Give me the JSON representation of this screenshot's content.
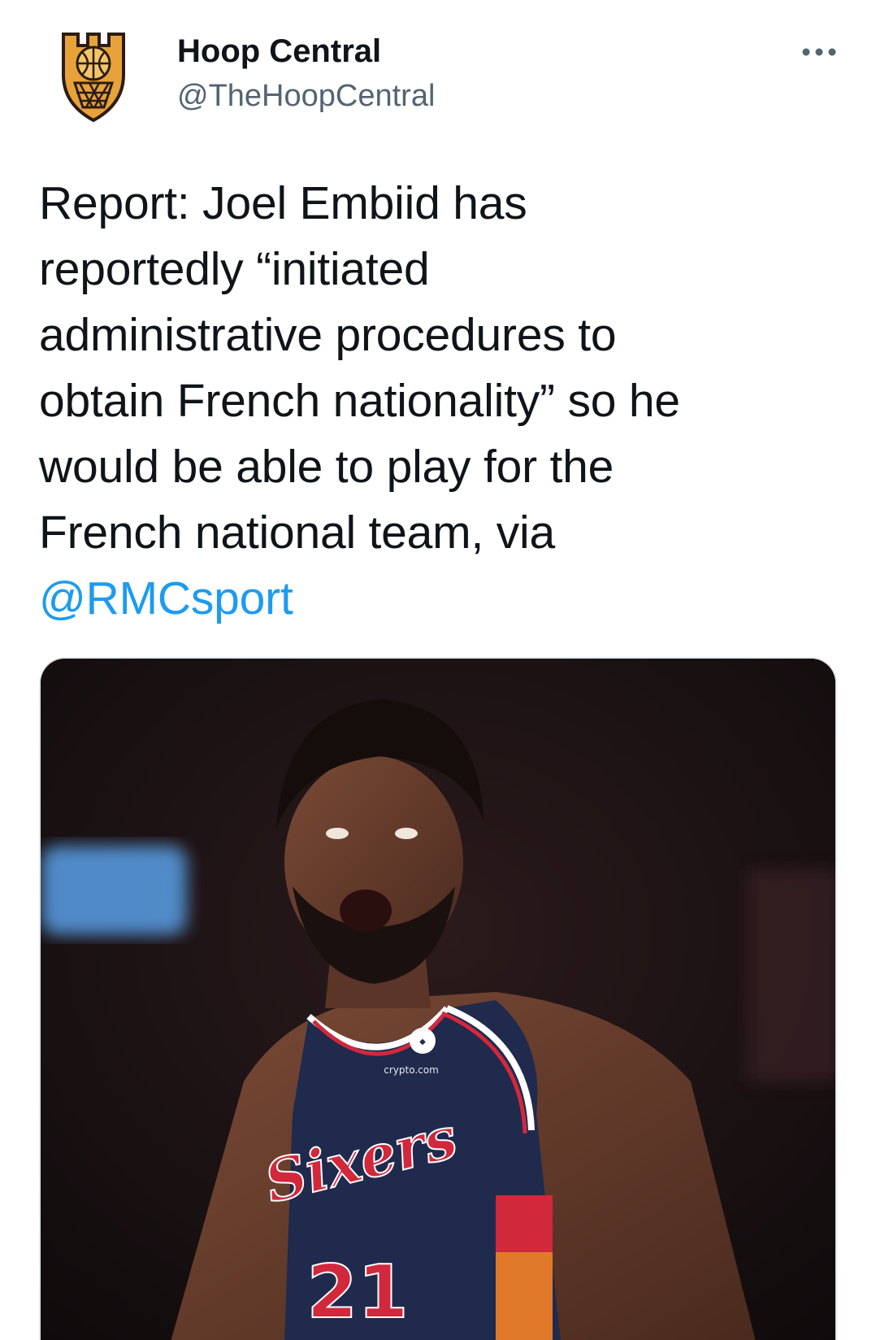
{
  "tweet": {
    "author": {
      "display_name": "Hoop Central",
      "handle": "@TheHoopCentral",
      "avatar_icon": "hoop-central-logo-icon"
    },
    "more_icon": "more-options-icon",
    "text_lines": [
      "Report: Joel Embiid has",
      "reportedly “initiated",
      "administrative procedures to",
      "obtain French nationality” so he",
      "would be able to play for the",
      "French national team, via"
    ],
    "mention": "@RMCsport",
    "media": {
      "jersey_sponsor": "crypto.com",
      "jersey_wordmark": "Sixers",
      "jersey_number": "21"
    },
    "colors": {
      "text": "#0f1419",
      "secondary_text": "#536471",
      "link": "#1d9bf0",
      "logo_gold": "#e8a23a",
      "jersey_navy": "#1f2a4d",
      "jersey_red": "#d2283c"
    }
  }
}
